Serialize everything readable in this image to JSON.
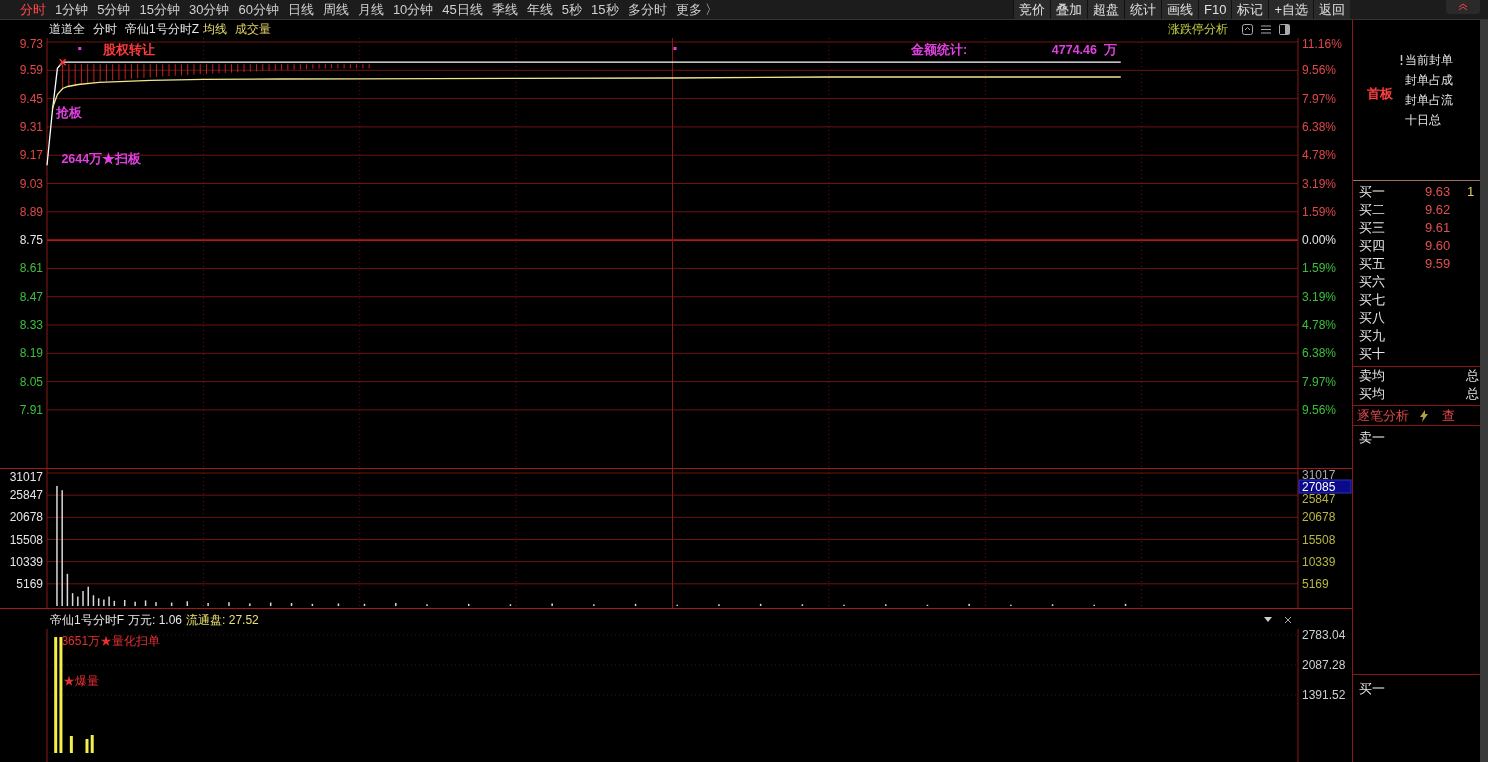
{
  "toolbar": {
    "periods": [
      {
        "label": "分时",
        "selected": true
      },
      {
        "label": "1分钟",
        "selected": false
      },
      {
        "label": "5分钟",
        "selected": false
      },
      {
        "label": "15分钟",
        "selected": false
      },
      {
        "label": "30分钟",
        "selected": false
      },
      {
        "label": "60分钟",
        "selected": false
      },
      {
        "label": "日线",
        "selected": false
      },
      {
        "label": "周线",
        "selected": false
      },
      {
        "label": "月线",
        "selected": false
      },
      {
        "label": "10分钟",
        "selected": false
      },
      {
        "label": "45日线",
        "selected": false
      },
      {
        "label": "季线",
        "selected": false
      },
      {
        "label": "年线",
        "selected": false
      },
      {
        "label": "5秒",
        "selected": false
      },
      {
        "label": "15秒",
        "selected": false
      },
      {
        "label": "多分时",
        "selected": false
      },
      {
        "label": "更多 〉",
        "selected": false
      }
    ],
    "actions": [
      "竞价",
      "叠加",
      "超盘",
      "统计",
      "画线",
      "F10",
      "标记",
      "+自选",
      "返回"
    ]
  },
  "price_panel": {
    "header": [
      {
        "text": "道道全",
        "kind": "name"
      },
      {
        "text": "分时",
        "kind": "name"
      },
      {
        "text": "帝仙1号分时Z",
        "kind": "name"
      },
      {
        "text": "均线",
        "kind": "avg"
      },
      {
        "text": "成交量",
        "kind": "vol"
      }
    ],
    "analysis_title": "涨跌停分析",
    "left_axis": [
      {
        "label": "9.73",
        "kind": "up"
      },
      {
        "label": "9.59",
        "kind": "up"
      },
      {
        "label": "9.45",
        "kind": "up"
      },
      {
        "label": "9.31",
        "kind": "up"
      },
      {
        "label": "9.17",
        "kind": "up"
      },
      {
        "label": "9.03",
        "kind": "up"
      },
      {
        "label": "8.89",
        "kind": "up"
      },
      {
        "label": "8.75",
        "kind": "flat"
      },
      {
        "label": "8.61",
        "kind": "down"
      },
      {
        "label": "8.47",
        "kind": "down"
      },
      {
        "label": "8.33",
        "kind": "down"
      },
      {
        "label": "8.19",
        "kind": "down"
      },
      {
        "label": "8.05",
        "kind": "down"
      },
      {
        "label": "7.91",
        "kind": "down"
      }
    ],
    "right_axis": [
      {
        "label": "11.16%",
        "kind": "up"
      },
      {
        "label": "9.56%",
        "kind": "up"
      },
      {
        "label": "7.97%",
        "kind": "up"
      },
      {
        "label": "6.38%",
        "kind": "up"
      },
      {
        "label": "4.78%",
        "kind": "up"
      },
      {
        "label": "3.19%",
        "kind": "up"
      },
      {
        "label": "1.59%",
        "kind": "up"
      },
      {
        "label": "0.00%",
        "kind": "flat"
      },
      {
        "label": "1.59%",
        "kind": "down"
      },
      {
        "label": "3.19%",
        "kind": "down"
      },
      {
        "label": "4.78%",
        "kind": "down"
      },
      {
        "label": "6.38%",
        "kind": "down"
      },
      {
        "label": "7.97%",
        "kind": "down"
      },
      {
        "label": "9.56%",
        "kind": "down"
      }
    ],
    "annotations": [
      {
        "text": "股权转让",
        "color": "#ff3b3b"
      },
      {
        "text": "金额统计:",
        "color": "#e040e0"
      },
      {
        "text": "4774.46  万",
        "color": "#e040e0"
      },
      {
        "text": "抢板",
        "color": "#e040e0"
      },
      {
        "text": "2644万★扫板",
        "color": "#e040e0"
      }
    ]
  },
  "volume_panel": {
    "left_axis": [
      "31017",
      "25847",
      "20678",
      "15508",
      "10339",
      "5169"
    ],
    "right_axis": [
      "31017",
      "25847",
      "20678",
      "15508",
      "10339",
      "5169"
    ],
    "cursor_value": "27085"
  },
  "indicator_panel": {
    "title": "帝仙1号分时F",
    "stats": [
      {
        "label": "万元:",
        "value": "1.06",
        "kind": "plain"
      },
      {
        "label": "流通盘:",
        "value": "27.52",
        "kind": "highlight"
      }
    ],
    "right_axis": [
      "2783.04",
      "2087.28",
      "1391.52"
    ],
    "annotations": [
      {
        "text": "3651万★量化扫单",
        "color": "#e53030"
      },
      {
        "text": "★爆量",
        "color": "#e53030"
      }
    ]
  },
  "side_panel": {
    "board": "首板",
    "seal_stats": [
      "当前封单",
      "封单占成",
      "封单占流",
      "十日总"
    ],
    "bids": [
      {
        "label": "买一",
        "price": "9.63",
        "volume": "1"
      },
      {
        "label": "买二",
        "price": "9.62"
      },
      {
        "label": "买三",
        "price": "9.61"
      },
      {
        "label": "买四",
        "price": "9.60"
      },
      {
        "label": "买五",
        "price": "9.59"
      },
      {
        "label": "买六"
      },
      {
        "label": "买七"
      },
      {
        "label": "买八"
      },
      {
        "label": "买九"
      },
      {
        "label": "买十"
      }
    ],
    "averages": [
      {
        "label": "卖均",
        "total": "总"
      },
      {
        "label": "买均",
        "total": "总"
      }
    ],
    "tick_title": "逐笔分析",
    "tick_link": "查",
    "tick_rows": [
      "卖一"
    ],
    "bottom_row": "买一"
  }
}
